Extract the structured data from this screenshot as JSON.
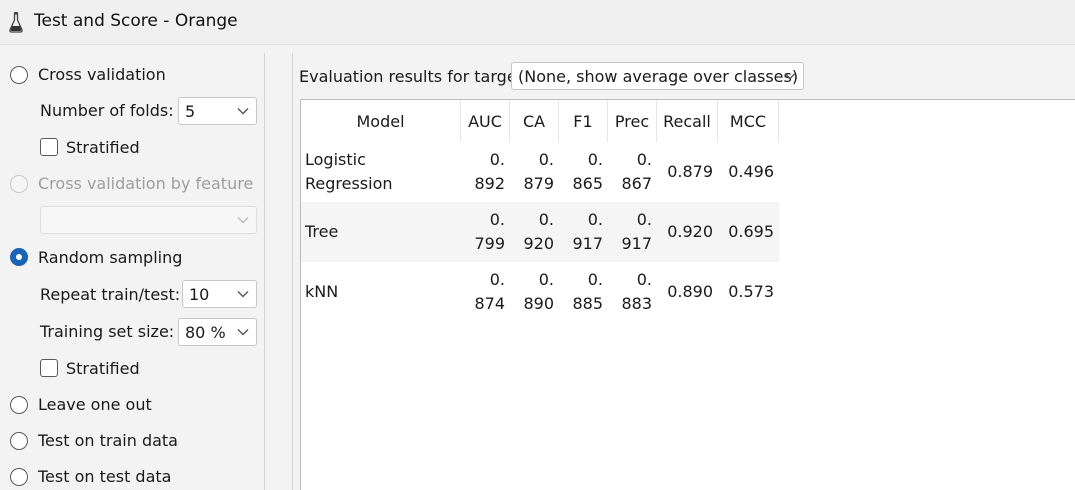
{
  "window": {
    "title": "Test and Score - Orange",
    "icon": "orange-flask-icon"
  },
  "sampling": {
    "cross_validation_label": "Cross validation",
    "number_of_folds_label": "Number of folds:",
    "number_of_folds_value": "5",
    "stratified_label": "Stratified",
    "cv_by_feature_label": "Cross validation by feature",
    "cv_by_feature_value": "",
    "random_sampling_label": "Random sampling",
    "repeat_label": "Repeat train/test:",
    "repeat_value": "10",
    "training_size_label": "Training set size:",
    "training_size_value": "80 %",
    "stratified2_label": "Stratified",
    "leave_one_out_label": "Leave one out",
    "test_on_train_label": "Test on train data",
    "test_on_test_label": "Test on test data",
    "selected": "Random sampling"
  },
  "results": {
    "target_label": "Evaluation results for target",
    "target_value": "(None, show average over classes)",
    "columns": [
      "Model",
      "AUC",
      "CA",
      "F1",
      "Prec",
      "Recall",
      "MCC"
    ],
    "rows": [
      {
        "model": "Logistic Regression",
        "auc": [
          "0.",
          "892"
        ],
        "ca": [
          "0.",
          "879"
        ],
        "f1": [
          "0.",
          "865"
        ],
        "prec": [
          "0.",
          "867"
        ],
        "recall": "0.879",
        "mcc": "0.496"
      },
      {
        "model": "Tree",
        "auc": [
          "0.",
          "799"
        ],
        "ca": [
          "0.",
          "920"
        ],
        "f1": [
          "0.",
          "917"
        ],
        "prec": [
          "0.",
          "917"
        ],
        "recall": "0.920",
        "mcc": "0.695"
      },
      {
        "model": "kNN",
        "auc": [
          "0.",
          "874"
        ],
        "ca": [
          "0.",
          "890"
        ],
        "f1": [
          "0.",
          "885"
        ],
        "prec": [
          "0.",
          "883"
        ],
        "recall": "0.890",
        "mcc": "0.573"
      }
    ]
  },
  "colors": {
    "accent": "#1b63b5",
    "alt_row": "#f5f5f5"
  }
}
